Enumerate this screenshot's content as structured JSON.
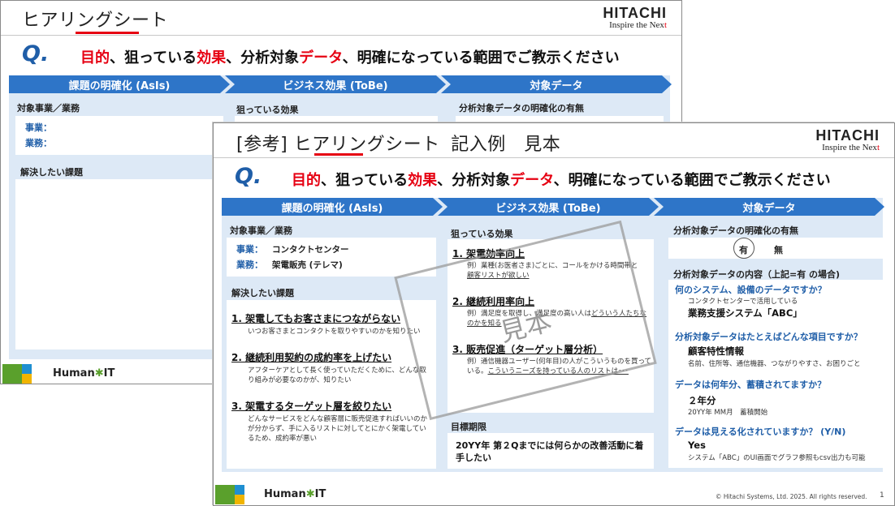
{
  "back_slide": {
    "title": "ヒアリングシート",
    "logo_main": "HITACHI",
    "logo_sub_a": "Inspire the Nex",
    "logo_sub_b": "t",
    "q_mark": "Q.",
    "question": [
      "目的",
      "、狙っている",
      "効果",
      "、分析対象",
      "データ",
      "、明確になっている範囲でご教示ください"
    ],
    "chevrons": [
      "課題の明確化 (AsIs)",
      "ビジネス効果 (ToBe)",
      "対象データ"
    ],
    "col1_label": "対象事業／業務",
    "biz_label": "事業：",
    "work_label": "業務：",
    "issue_label": "解決したい課題",
    "col2_label": "狙っている効果",
    "col3_label": "分析対象データの明確化の有無",
    "footer_brand_a": "Human",
    "footer_star": "✱",
    "footer_brand_b": "IT"
  },
  "front_slide": {
    "title_bracket": "[参考]",
    "title_main": "ヒアリングシート",
    "title_suffix": "記入例　見本",
    "logo_main": "HITACHI",
    "logo_sub_a": "Inspire the Nex",
    "logo_sub_b": "t",
    "q_mark": "Q.",
    "question": [
      "目的",
      "、狙っている",
      "効果",
      "、分析対象",
      "データ",
      "、明確になっている範囲でご教示ください"
    ],
    "chevrons": [
      "課題の明確化 (AsIs)",
      "ビジネス効果 (ToBe)",
      "対象データ"
    ],
    "col1": {
      "label": "対象事業／業務",
      "biz_label": "事業：",
      "biz_value": "コンタクトセンター",
      "work_label": "業務：",
      "work_value": "架電販売 (テレマ)",
      "issue_label": "解決したい課題",
      "issues": [
        {
          "title": "1. 架電してもお客さまにつながらない",
          "desc": "いつお客さまとコンタクトを取りやすいのかを知りたい"
        },
        {
          "title": "2. 継続利用契約の成約率を上げたい",
          "desc": "アフターケアとして長く使っていただくために、どんな取り組みが必要なのかが、知りたい"
        },
        {
          "title": "3. 架電するターゲット層を絞りたい",
          "desc": "どんなサービスをどんな顧客層に販売促進すればいいのかが分からず、手に入るリストに対してとにかく架電しているため、成約率が悪い"
        }
      ]
    },
    "col2": {
      "label": "狙っている効果",
      "effects": [
        {
          "title": "1. 架電効率向上",
          "desc_a": "例）業種(お医者さま)ごとに、コールをかける時間帯と",
          "desc_b": "顧客リストが欲しい"
        },
        {
          "title": "2. 継続利用率向上",
          "desc_a": "例）満足度を取得し、満足度の高い人は",
          "desc_u": "どういう人たちなのかを知る",
          "desc_b": ""
        },
        {
          "title": "3. 販売促進（ターゲット層分析）",
          "desc_a": "例）通信機器ユーザー(何年目)の人がこういうものを買っている。",
          "desc_u": "こういうニーズを持っている人のリストは･･･",
          "desc_b": ""
        }
      ],
      "deadline_label": "目標期限",
      "deadline_value": "20YY年 第２Qまでには何らかの改善活動に着手したい"
    },
    "col3": {
      "label": "分析対象データの明確化の有無",
      "yes": "有",
      "no": "無",
      "content_label": "分析対象データの内容（上記=有 の場合)",
      "qa": [
        {
          "q": "何のシステム、設備のデータですか？",
          "note": "コンタクトセンターで活用している",
          "a": "業務支援システム「ABC」"
        },
        {
          "q": "分析対象データはたとえばどんな項目ですか？",
          "a": "顧客特性情報",
          "note2": "名前、住所等、通信機器、つながりやすさ、お困りごと"
        },
        {
          "q": "データは何年分、蓄積されてますか？",
          "a": "２年分",
          "note2": "20YY年 MM月　蓄積開始"
        },
        {
          "q": "データは見える化されていますか？ (Y/N)",
          "a": "Yes",
          "note2": "システム「ABC」のUI画面でグラフ参照もcsv出力も可能"
        }
      ]
    },
    "stamp_text": "見本",
    "footer_brand_a": "Human",
    "footer_star": "✱",
    "footer_brand_b": "IT",
    "copyright": "© Hitachi Systems, Ltd. 2025. All rights reserved.",
    "page_number": "1"
  },
  "colors": {
    "accent_red": "#e60012",
    "chevron_blue": "#2e75c8",
    "panel_bg": "#dde9f6",
    "heading_blue": "#1f5ea8"
  }
}
